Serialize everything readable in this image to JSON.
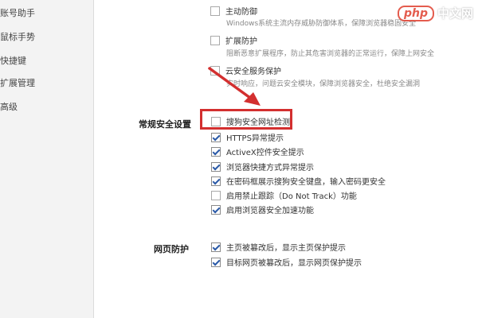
{
  "sidebar": {
    "items": [
      {
        "label": "账号助手"
      },
      {
        "label": "鼠标手势"
      },
      {
        "label": "快捷键"
      },
      {
        "label": "扩展管理"
      },
      {
        "label": "高级"
      }
    ]
  },
  "top_options": [
    {
      "label": "主动防御",
      "desc": "Windows系统主流内存威胁防御体系，保障浏览器稳固安全",
      "checked": false
    },
    {
      "label": "扩展防护",
      "desc": "阻断恶意扩展程序，防止其危害浏览器的正常运行，保障上网安全",
      "checked": false
    },
    {
      "label": "云安全服务保护",
      "desc": "实时响应，问题云安全模块，保障浏览器安全，杜绝安全漏洞",
      "checked": false
    }
  ],
  "general_security": {
    "label": "常规安全设置",
    "options": [
      {
        "label": "搜狗安全网址检测",
        "checked": false
      },
      {
        "label": "HTTPS异常提示",
        "checked": true
      },
      {
        "label": "ActiveX控件安全提示",
        "checked": true
      },
      {
        "label": "浏览器快捷方式异常提示",
        "checked": true
      },
      {
        "label": "在密码框展示搜狗安全键盘，输入密码更安全",
        "checked": true
      },
      {
        "label": "启用禁止跟踪（Do Not Track）功能",
        "checked": false
      },
      {
        "label": "启用浏览器安全加速功能",
        "checked": true
      }
    ]
  },
  "web_protection": {
    "label": "网页防护",
    "options": [
      {
        "label": "主页被篡改后，显示主页保护提示",
        "checked": true
      },
      {
        "label": "目标网页被篡改后，显示网页保护提示",
        "checked": true
      }
    ]
  },
  "watermark": {
    "logo": "php",
    "text": "中文网"
  },
  "colors": {
    "highlight": "#d32f2f",
    "arrow": "#d32f2f",
    "checkmark": "#2b5aa8"
  }
}
